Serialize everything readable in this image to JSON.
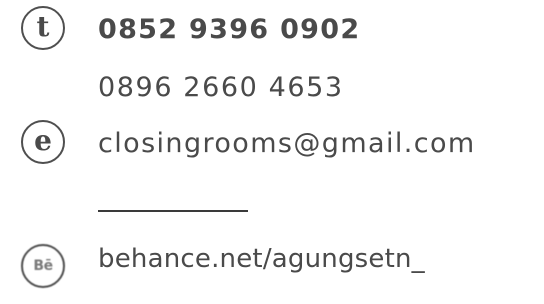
{
  "contact": {
    "phone_icon_glyph": "t",
    "phone_primary": "0852 9396 0902",
    "phone_secondary": "0896 2660 4653",
    "email_icon_glyph": "e",
    "email": "closingrooms@gmail.com",
    "behance_icon_glyph": "Bē",
    "behance": "behance.net/agungsetn_"
  },
  "icons": {
    "phone": "telephone-letter-icon",
    "email": "email-letter-icon",
    "behance": "behance-icon"
  },
  "colors": {
    "text": "#4a4a4a",
    "icon_border": "#4f4f4f",
    "divider": "#3a3a3a",
    "background": "#ffffff"
  }
}
